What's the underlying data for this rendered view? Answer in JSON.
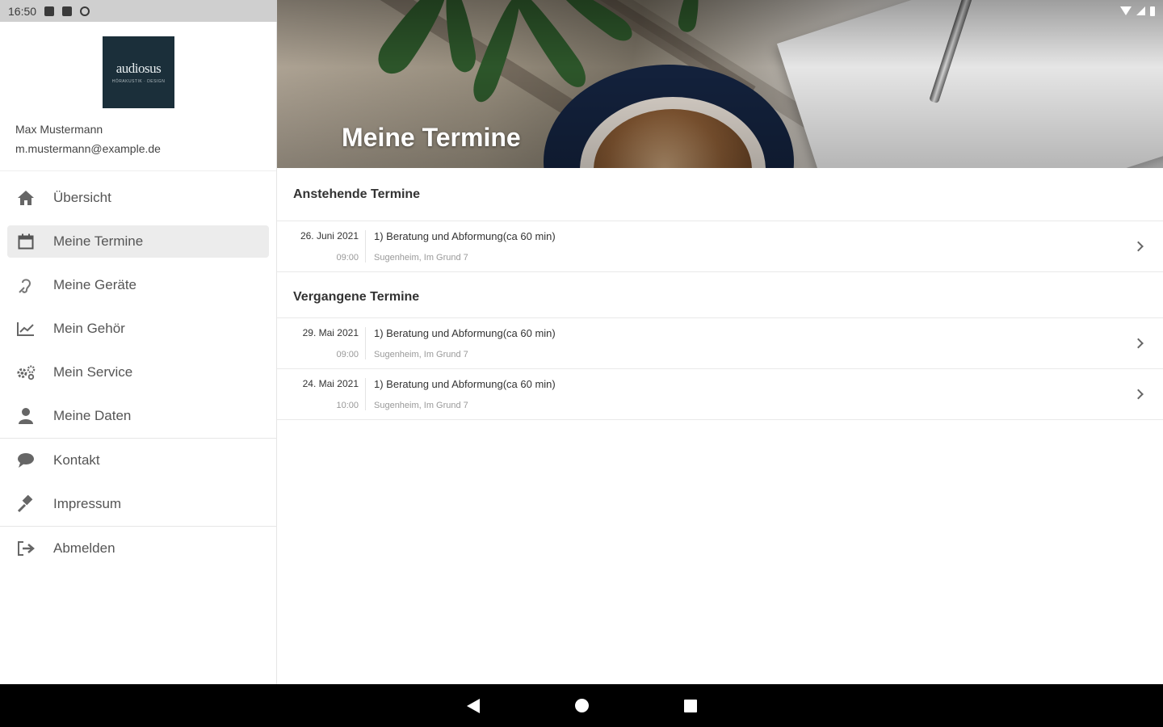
{
  "status_bar": {
    "time": "16:50"
  },
  "profile": {
    "logo_brand": "audiosus",
    "logo_tagline": "HÖRAKUSTIK · DESIGN",
    "name": "Max Mustermann",
    "email": "m.mustermann@example.de"
  },
  "nav": {
    "items": [
      {
        "label": "Übersicht",
        "icon": "home-icon"
      },
      {
        "label": "Meine Termine",
        "icon": "calendar-icon",
        "active": true
      },
      {
        "label": "Meine Geräte",
        "icon": "hearing-icon"
      },
      {
        "label": "Mein Gehör",
        "icon": "chart-icon"
      },
      {
        "label": "Mein Service",
        "icon": "gears-icon"
      },
      {
        "label": "Meine Daten",
        "icon": "user-icon"
      },
      {
        "label": "Kontakt",
        "icon": "chat-icon"
      },
      {
        "label": "Impressum",
        "icon": "gavel-icon"
      },
      {
        "label": "Abmelden",
        "icon": "logout-icon"
      }
    ]
  },
  "header": {
    "title": "Meine Termine"
  },
  "upcoming": {
    "title": "Anstehende Termine",
    "items": [
      {
        "date": "26. Juni 2021",
        "time": "09:00",
        "title": "1) Beratung und Abformung(ca 60 min)",
        "location": "Sugenheim, Im Grund 7"
      }
    ]
  },
  "past": {
    "title": "Vergangene Termine",
    "items": [
      {
        "date": "29. Mai 2021",
        "time": "09:00",
        "title": "1) Beratung und Abformung(ca 60 min)",
        "location": "Sugenheim, Im Grund 7"
      },
      {
        "date": "24. Mai 2021",
        "time": "10:00",
        "title": "1) Beratung und Abformung(ca 60 min)",
        "location": "Sugenheim, Im Grund 7"
      }
    ]
  },
  "colors": {
    "logo_bg": "#1b2f3a",
    "active_nav_bg": "#ececec",
    "nav_bar": "#000000"
  }
}
